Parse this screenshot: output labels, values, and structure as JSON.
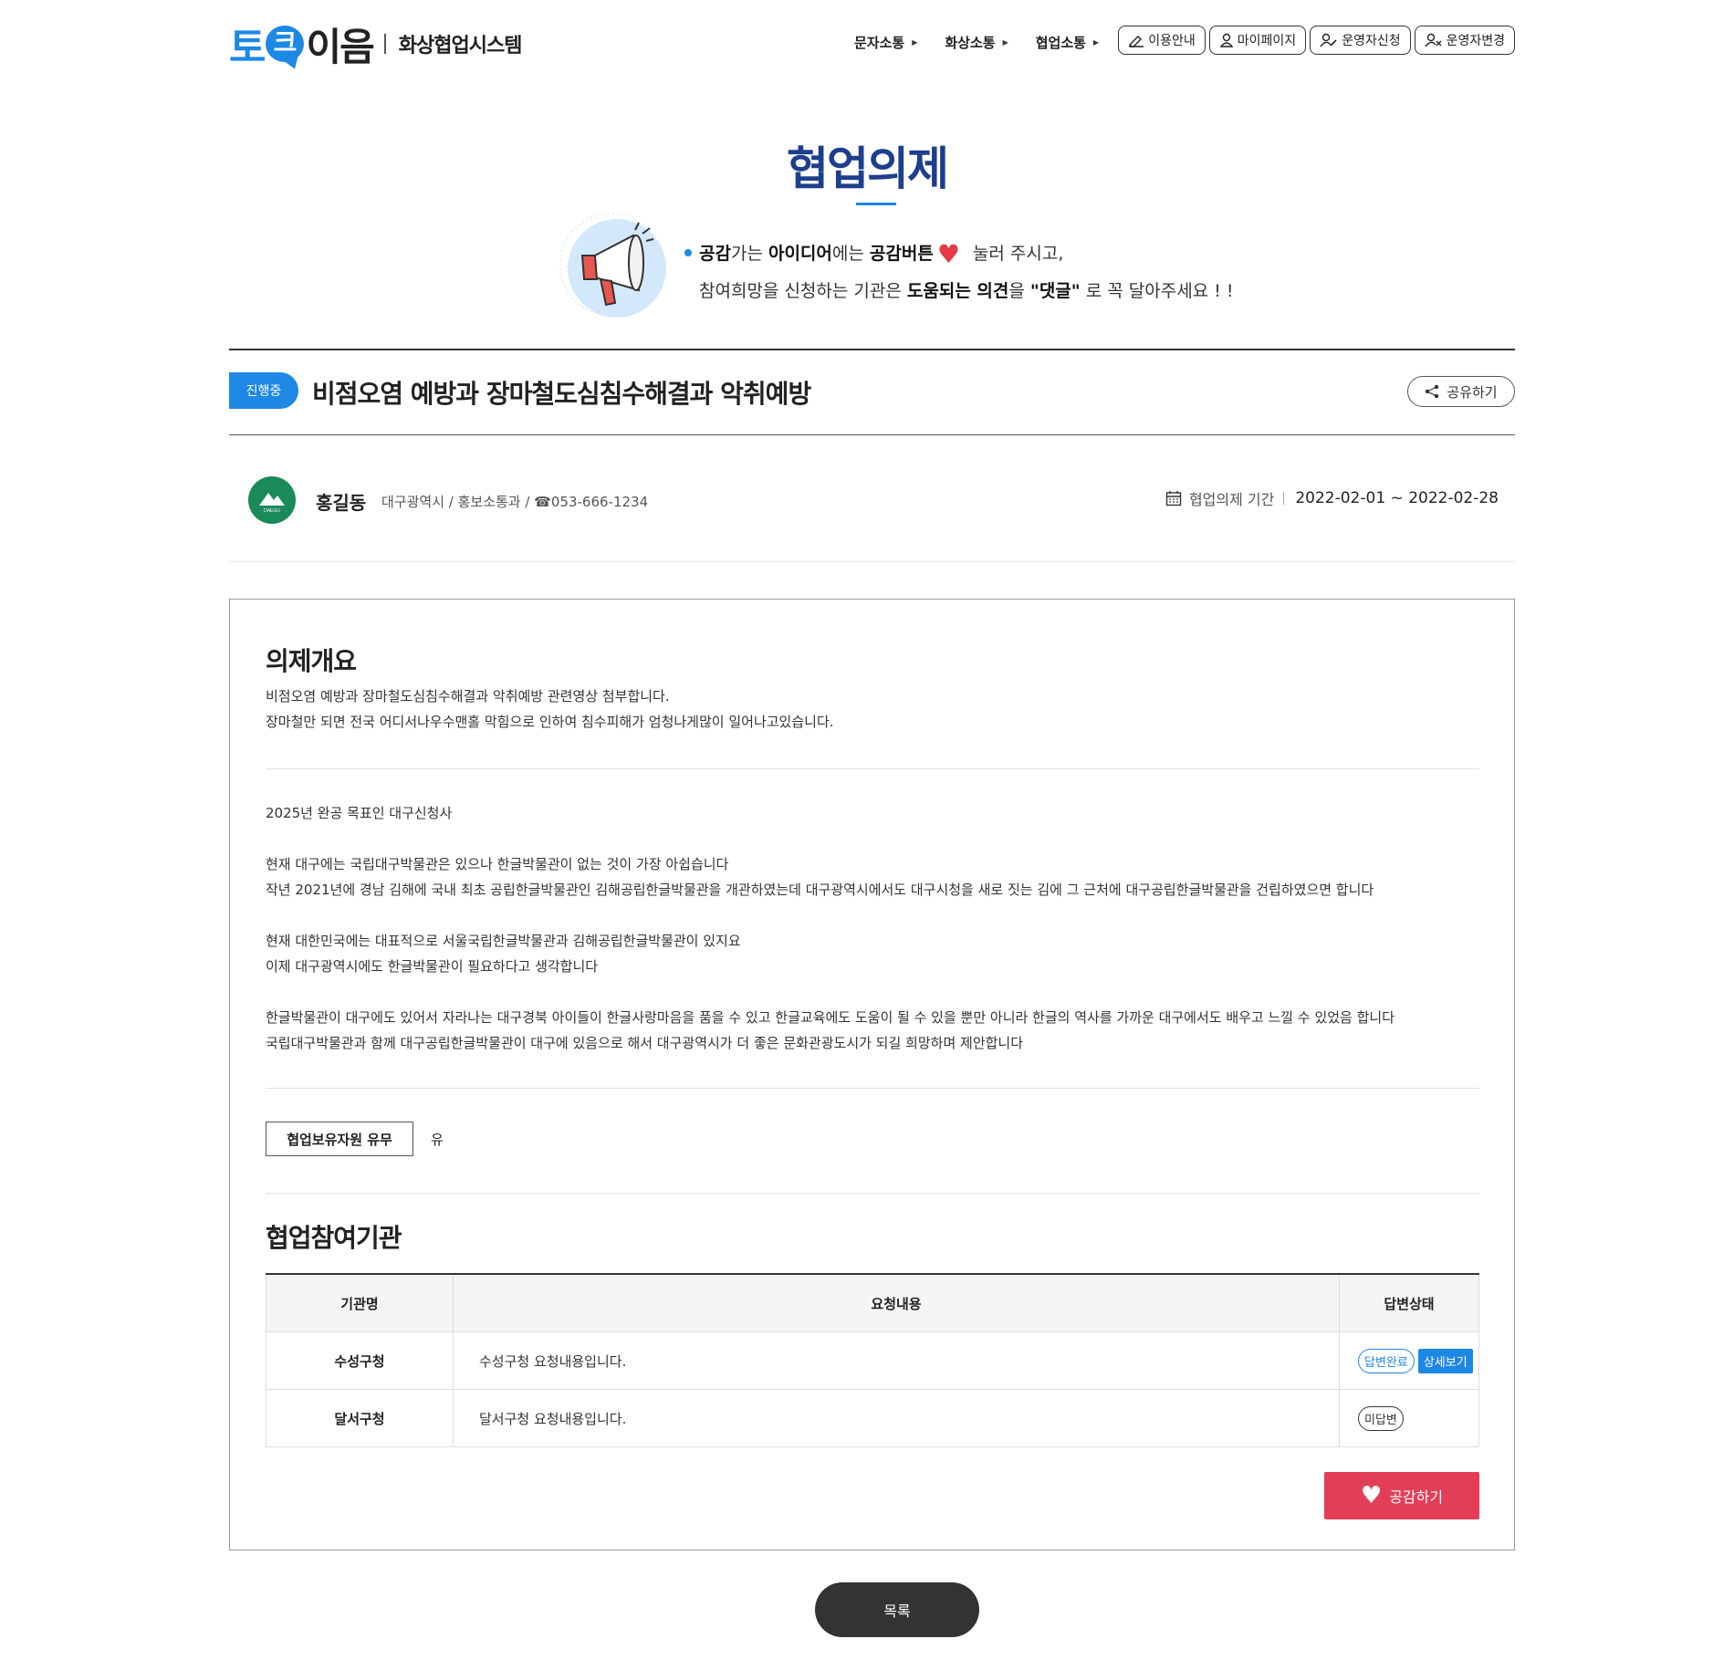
{
  "header": {
    "logo_to": "토",
    "logo_k": "크",
    "logo_eum": "이음",
    "system_name": "화상협업시스템",
    "nav": [
      "문자소통",
      "화상소통",
      "협업소통"
    ],
    "buttons": [
      "이용안내",
      "마이페이지",
      "운영자신청",
      "운영자변경"
    ]
  },
  "page": {
    "title": "협업의제",
    "guide_line1_parts": [
      "공감",
      "가는 ",
      "아이디어",
      "에는 ",
      "공감버튼",
      "눌러 주시고,"
    ],
    "guide_line2_parts": [
      "참여희망을 신청하는 기관은 ",
      "도움되는 의견",
      "을 ",
      "\"댓글\"",
      " 로 꼭 달아주세요 ! !"
    ]
  },
  "agenda": {
    "status": "진행중",
    "title": "비점오염 예방과 장마철도심침수해결과 악취예방",
    "share_label": "공유하기",
    "author": {
      "name": "홍길동",
      "info": "대구광역시 / 홍보소통과 / ☎053-666-1234",
      "avatar_text": "DAEGU"
    },
    "period_label": "협업의제 기간",
    "period_value": "2022-02-01 ~ 2022-02-28"
  },
  "overview": {
    "heading": "의제개요",
    "summary_lines": [
      "비점오염 예방과 장마철도심침수해결과 악취예방 관련영상 첨부합니다.",
      "장마철만 되면 전국 어디서나우수맨홀 막힘으로 인하여 침수피해가 엄청나게많이 일어나고있습니다."
    ],
    "body_lines": [
      "2025년 완공 목표인 대구신청사",
      "",
      "현재 대구에는 국립대구박물관은 있으나 한글박물관이 없는 것이 가장 아쉽습니다",
      "작년 2021년에 경남 김해에 국내 최초 공립한글박물관인 김해공립한글박물관을 개관하였는데 대구광역시에서도 대구시청을 새로 짓는 김에 그 근처에 대구공립한글박물관을 건립하였으면 합니다",
      "",
      "현재 대한민국에는 대표적으로 서울국립한글박물관과 김해공립한글박물관이 있지요",
      "이제 대구광역시에도 한글박물관이 필요하다고 생각합니다",
      "",
      "한글박물관이 대구에도 있어서 자라나는 대구경북 아이들이 한글사랑마음을 품을 수 있고 한글교육에도 도움이 될 수 있을 뿐만 아니라 한글의 역사를 가까운 대구에서도 배우고 느낄 수 있었음 합니다",
      "국립대구박물관과 함께 대구공립한글박물관이 대구에 있음으로 해서 대구광역시가 더 좋은 문화관광도시가 되길 희망하며 제안합니다"
    ],
    "resource_label": "협업보유자원 유무",
    "resource_value": "유"
  },
  "participants": {
    "heading": "협업참여기관",
    "columns": [
      "기관명",
      "요청내용",
      "답변상태"
    ],
    "rows": [
      {
        "org": "수성구청",
        "request": "수성구청 요청내용입니다.",
        "status": "답변완료",
        "detail": "상세보기"
      },
      {
        "org": "달서구청",
        "request": "달서구청 요청내용입니다.",
        "status": "미답변",
        "detail": ""
      }
    ]
  },
  "actions": {
    "like_label": "공감하기",
    "list_label": "목록"
  },
  "colors": {
    "brand_blue": "#1e88e5",
    "title_navy": "#1d3f8c",
    "like_red": "#e23e57",
    "avatar_green": "#1a8a5a"
  }
}
